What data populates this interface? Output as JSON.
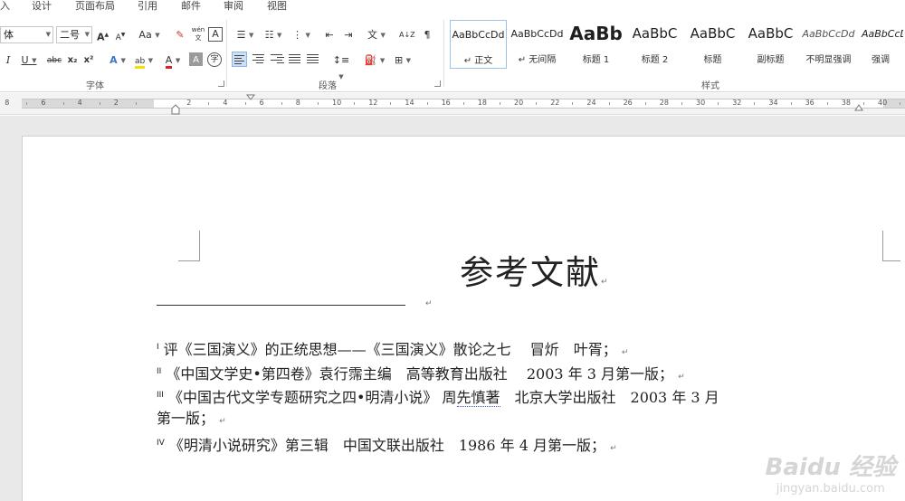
{
  "menu_tabs": [
    "入",
    "设计",
    "页面布局",
    "引用",
    "邮件",
    "审阅",
    "视图"
  ],
  "font": {
    "name": "体",
    "size": "二号",
    "group_label": "字体"
  },
  "paragraph": {
    "group_label": "段落"
  },
  "styles": {
    "group_label": "样式",
    "items": [
      {
        "sample": "AaBbCcDd",
        "name": "正文"
      },
      {
        "sample": "AaBbCcDd",
        "name": "无间隔"
      },
      {
        "sample": "AaBb",
        "name": "标题 1"
      },
      {
        "sample": "AaBbC",
        "name": "标题 2"
      },
      {
        "sample": "AaBbC",
        "name": "标题"
      },
      {
        "sample": "AaBbC",
        "name": "副标题"
      },
      {
        "sample": "AaBbCcDd",
        "name": "不明显强调"
      },
      {
        "sample": "AaBbCcDd",
        "name": "强调"
      }
    ]
  },
  "ruler": {
    "labels": [
      "8",
      "6",
      "4",
      "2",
      "2",
      "4",
      "6",
      "8",
      "10",
      "12",
      "14",
      "16",
      "18",
      "20",
      "22",
      "24",
      "26",
      "28",
      "30",
      "32",
      "34",
      "36",
      "38",
      "40"
    ]
  },
  "ribbon_glyphs": {
    "grow": "A",
    "shrink": "A",
    "case": "Aa",
    "clear": "✎",
    "phonetic": "wén",
    "border_char": "A",
    "italic": "I",
    "underline": "U",
    "strike": "abc",
    "sub": "x₂",
    "sup": "x²",
    "effects": "A",
    "highlight": "ab",
    "font_color": "A",
    "shading": "A",
    "circle": "字",
    "sort": "A↓Z",
    "show_marks": "¶",
    "text_dir": "文"
  },
  "document": {
    "title": "参考文献",
    "footnotes": [
      {
        "mark": "I",
        "text": "评《三国演义》的正统思想——《三国演义》散论之七　 冒炘　叶胥；"
      },
      {
        "mark": "II",
        "text": "《中国文学史•第四卷》袁行霈主编　高等教育出版社　 2003 年 3 月第一版；"
      },
      {
        "mark": "III",
        "pre": "《中国古代文学专题研究之四•明清小说》 周",
        "squig": "先慎著",
        "post": "　北京大学出版社　2003 年 3 月"
      },
      {
        "cont": "第一版；"
      },
      {
        "mark": "IV",
        "text": "《明清小说研究》第三辑　中国文联出版社　1986 年 4 月第一版；"
      }
    ]
  },
  "watermark": {
    "brand": "Baidu 经验",
    "url": "jingyan.baidu.com"
  }
}
